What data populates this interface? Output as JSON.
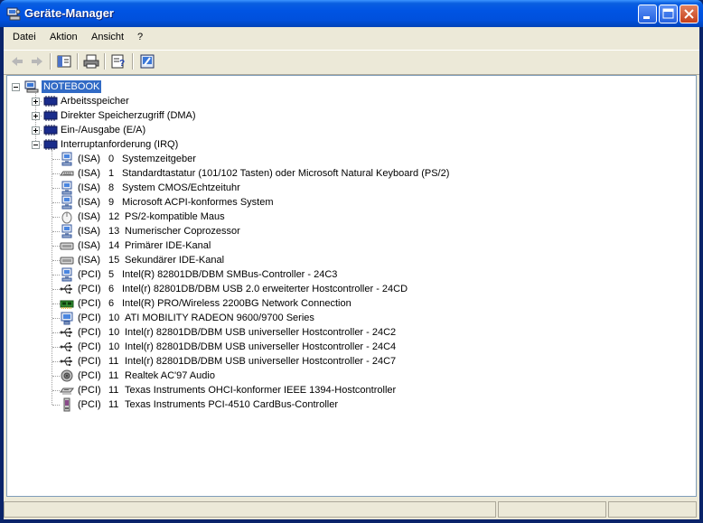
{
  "window": {
    "title": "Geräte-Manager",
    "accent": "#0054e3"
  },
  "menu": [
    "Datei",
    "Aktion",
    "Ansicht",
    "?"
  ],
  "toolbar": {
    "buttons": [
      "back-arrow-icon",
      "forward-arrow-icon",
      "show-hide-tree-icon",
      "print-icon",
      "properties-icon",
      "update-driver-icon"
    ]
  },
  "tree": {
    "root": "NOTEBOOK",
    "categories": [
      {
        "label": "Arbeitsspeicher",
        "expanded": false
      },
      {
        "label": "Direkter Speicherzugriff (DMA)",
        "expanded": false
      },
      {
        "label": "Ein-/Ausgabe (E/A)",
        "expanded": false
      },
      {
        "label": "Interruptanforderung (IRQ)",
        "expanded": true
      }
    ],
    "irq_entries": [
      {
        "bus": "(ISA)",
        "irq": "0",
        "device": "Systemzeitgeber",
        "icon": "monitor-computer-icon"
      },
      {
        "bus": "(ISA)",
        "irq": "1",
        "device": "Standardtastatur (101/102 Tasten) oder Microsoft Natural Keyboard (PS/2)",
        "icon": "keyboard-icon"
      },
      {
        "bus": "(ISA)",
        "irq": "8",
        "device": "System CMOS/Echtzeituhr",
        "icon": "monitor-computer-icon"
      },
      {
        "bus": "(ISA)",
        "irq": "9",
        "device": "Microsoft ACPI-konformes System",
        "icon": "monitor-computer-icon"
      },
      {
        "bus": "(ISA)",
        "irq": "12",
        "device": "PS/2-kompatible Maus",
        "icon": "mouse-icon"
      },
      {
        "bus": "(ISA)",
        "irq": "13",
        "device": "Numerischer Coprozessor",
        "icon": "monitor-computer-icon"
      },
      {
        "bus": "(ISA)",
        "irq": "14",
        "device": "Primärer IDE-Kanal",
        "icon": "ide-controller-icon"
      },
      {
        "bus": "(ISA)",
        "irq": "15",
        "device": "Sekundärer IDE-Kanal",
        "icon": "ide-controller-icon"
      },
      {
        "bus": "(PCI)",
        "irq": "5",
        "device": "Intel(R) 82801DB/DBM SMBus-Controller - 24C3",
        "icon": "monitor-computer-icon"
      },
      {
        "bus": "(PCI)",
        "irq": "6",
        "device": "Intel(r) 82801DB/DBM USB 2.0 erweiterter Hostcontroller - 24CD",
        "icon": "usb-icon"
      },
      {
        "bus": "(PCI)",
        "irq": "6",
        "device": "Intel(R) PRO/Wireless 2200BG Network Connection",
        "icon": "network-card-icon"
      },
      {
        "bus": "(PCI)",
        "irq": "10",
        "device": "ATI MOBILITY RADEON 9600/9700 Series",
        "icon": "display-adapter-icon"
      },
      {
        "bus": "(PCI)",
        "irq": "10",
        "device": "Intel(r) 82801DB/DBM USB universeller Hostcontroller - 24C2",
        "icon": "usb-icon"
      },
      {
        "bus": "(PCI)",
        "irq": "10",
        "device": "Intel(r) 82801DB/DBM USB universeller Hostcontroller - 24C4",
        "icon": "usb-icon"
      },
      {
        "bus": "(PCI)",
        "irq": "11",
        "device": "Intel(r) 82801DB/DBM USB universeller Hostcontroller - 24C7",
        "icon": "usb-icon"
      },
      {
        "bus": "(PCI)",
        "irq": "11",
        "device": "Realtek AC'97 Audio",
        "icon": "speaker-icon"
      },
      {
        "bus": "(PCI)",
        "irq": "11",
        "device": "Texas Instruments OHCI-konformer IEEE 1394-Hostcontroller",
        "icon": "firewire-icon"
      },
      {
        "bus": "(PCI)",
        "irq": "11",
        "device": "Texas Instruments PCI-4510 CardBus-Controller",
        "icon": "pcmcia-card-icon"
      }
    ]
  }
}
